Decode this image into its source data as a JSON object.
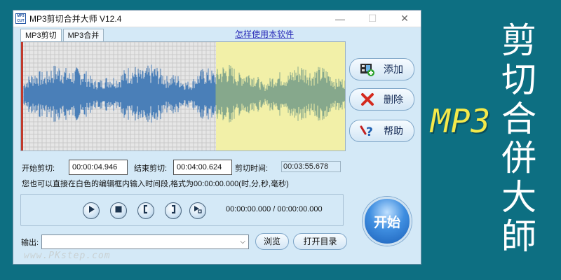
{
  "window": {
    "title": "MP3剪切合并大师 V12.4",
    "app_icon_text": "MP3 CUT",
    "minimize": "—",
    "maximize": "☐",
    "close": "✕"
  },
  "tabs": [
    {
      "label": "MP3剪切",
      "active": true
    },
    {
      "label": "MP3合并",
      "active": false
    }
  ],
  "help_link": "怎样使用本软件",
  "side_buttons": {
    "add": {
      "label": "添加",
      "icon": "film-add-icon"
    },
    "delete": {
      "label": "删除",
      "icon": "red-x-icon"
    },
    "help": {
      "label": "帮助",
      "icon": "help-question-icon"
    }
  },
  "waveform": {
    "selection_start_fraction": 0.6,
    "background_color": "#e6e6e6",
    "selection_color": "#f2f0a8",
    "wave_color": "#4a7fb8",
    "wave_selected_color": "#86a88c"
  },
  "times": {
    "start_label": "开始剪切:",
    "start_value": "00:00:04.946",
    "end_label": "结束剪切:",
    "end_value": "00:04:00.624",
    "duration_label": "剪切时间:",
    "duration_value": "00:03:55.678"
  },
  "hint": "您也可以直接在白色的编辑框内输入时间段,格式为00:00:00.000(时,分,秒,毫秒)",
  "transport": {
    "buttons": [
      "play-icon",
      "stop-icon",
      "mark-start-icon",
      "mark-end-icon",
      "play-selection-icon"
    ],
    "position": "00:00:00.000 / 00:00:00.000"
  },
  "start_button": "开始",
  "output": {
    "label": "输出:",
    "value": "",
    "browse": "浏览",
    "open_dir": "打开目录"
  },
  "promo": {
    "mp3": "MP3",
    "title": "剪切合併大師"
  },
  "watermark": "www.PKstep.com"
}
